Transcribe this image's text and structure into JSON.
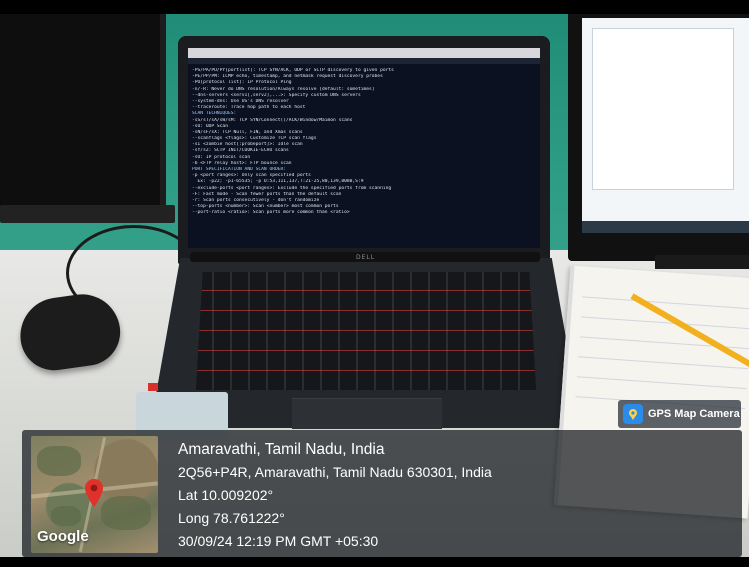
{
  "overlay": {
    "app_badge": "GPS Map Camera",
    "app_icon": "map-pin-icon",
    "title": "Amaravathi, Tamil Nadu, India",
    "address": "2Q56+P4R, Amaravathi, Tamil Nadu 630301, India",
    "latitude": "Lat 10.009202°",
    "longitude": "Long 78.761222°",
    "datetime": "30/09/24 12:19 PM GMT +05:30",
    "map_provider": "Google",
    "pin_color": "#e0312b",
    "badge_color": "#2a8be8"
  },
  "scene": {
    "laptop_brand": "DELL",
    "terminal_lines": [
      "-PS/PA/PU/PY[portlist]: TCP SYN/ACK, UDP or SCTP discovery to given ports",
      "-PE/PP/PM: ICMP echo, timestamp, and netmask request discovery probes",
      "-PO[protocol list]: IP Protocol Ping",
      "-n/-R: Never do DNS resolution/Always resolve [default: sometimes]",
      "--dns-servers <serv1[,serv2],...>: Specify custom DNS servers",
      "--system-dns: Use OS's DNS resolver",
      "--traceroute: Trace hop path to each host",
      "SCAN TECHNIQUES:",
      "-sS/sT/sA/sW/sM: TCP SYN/Connect()/ACK/Window/Maimon scans",
      "-sU: UDP Scan",
      "-sN/sF/sX: TCP Null, FIN, and Xmas scans",
      "--scanflags <flags>: Customize TCP scan flags",
      "-sI <zombie host[:probeport]>: Idle scan",
      "-sY/sZ: SCTP INIT/COOKIE-ECHO scans",
      "-sO: IP protocol scan",
      "-b <FTP relay host>: FTP bounce scan",
      "PORT SPECIFICATION AND SCAN ORDER:",
      "-p <port ranges>: Only scan specified ports",
      "  Ex: -p22; -p1-65535; -p U:53,111,137,T:21-25,80,139,8080,S:9",
      "--exclude-ports <port ranges>: Exclude the specified ports from scanning",
      "-F: Fast mode - Scan fewer ports than the default scan",
      "-r: Scan ports consecutively - don't randomize",
      "--top-ports <number>: Scan <number> most common ports",
      "--port-ratio <ratio>: Scan ports more common than <ratio>"
    ]
  }
}
